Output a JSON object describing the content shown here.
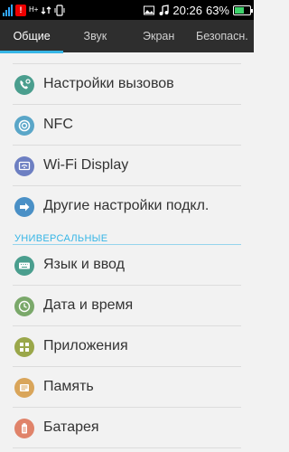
{
  "status_bar": {
    "time": "20:26",
    "battery_percent": "63%",
    "battery_level": 0.63,
    "data_label": "H+",
    "alert_glyph": "!",
    "icons": [
      "signal-icon",
      "notification-alert-icon",
      "h-plus-data-icon",
      "sync-icon",
      "vibrate-icon",
      "image-icon",
      "music-icon",
      "battery-icon"
    ]
  },
  "tabs": [
    {
      "label": "Общие",
      "active": true
    },
    {
      "label": "Звук",
      "active": false
    },
    {
      "label": "Экран",
      "active": false
    },
    {
      "label": "Безопасн.",
      "active": false
    }
  ],
  "items_top": [
    {
      "label": "Настройки вызовов",
      "icon": "phone-settings-icon",
      "color": "#4a9e8e"
    },
    {
      "label": "NFC",
      "icon": "nfc-icon",
      "color": "#5aa6c8"
    },
    {
      "label": "Wi-Fi Display",
      "icon": "wifi-display-icon",
      "color": "#6d7fc2"
    },
    {
      "label": "Другие настройки подкл.",
      "icon": "more-connections-icon",
      "color": "#4a90c6"
    }
  ],
  "section_title": "УНИВЕРСАЛЬНЫЕ",
  "items_bottom": [
    {
      "label": "Язык и ввод",
      "icon": "keyboard-icon",
      "color": "#4a9e8e"
    },
    {
      "label": "Дата и время",
      "icon": "clock-icon",
      "color": "#7aa86a"
    },
    {
      "label": "Приложения",
      "icon": "apps-icon",
      "color": "#9aa74a"
    },
    {
      "label": "Память",
      "icon": "storage-icon",
      "color": "#d9a55a"
    },
    {
      "label": "Батарея",
      "icon": "battery-settings-icon",
      "color": "#e0836a"
    }
  ],
  "accent_color": "#37b6e6"
}
